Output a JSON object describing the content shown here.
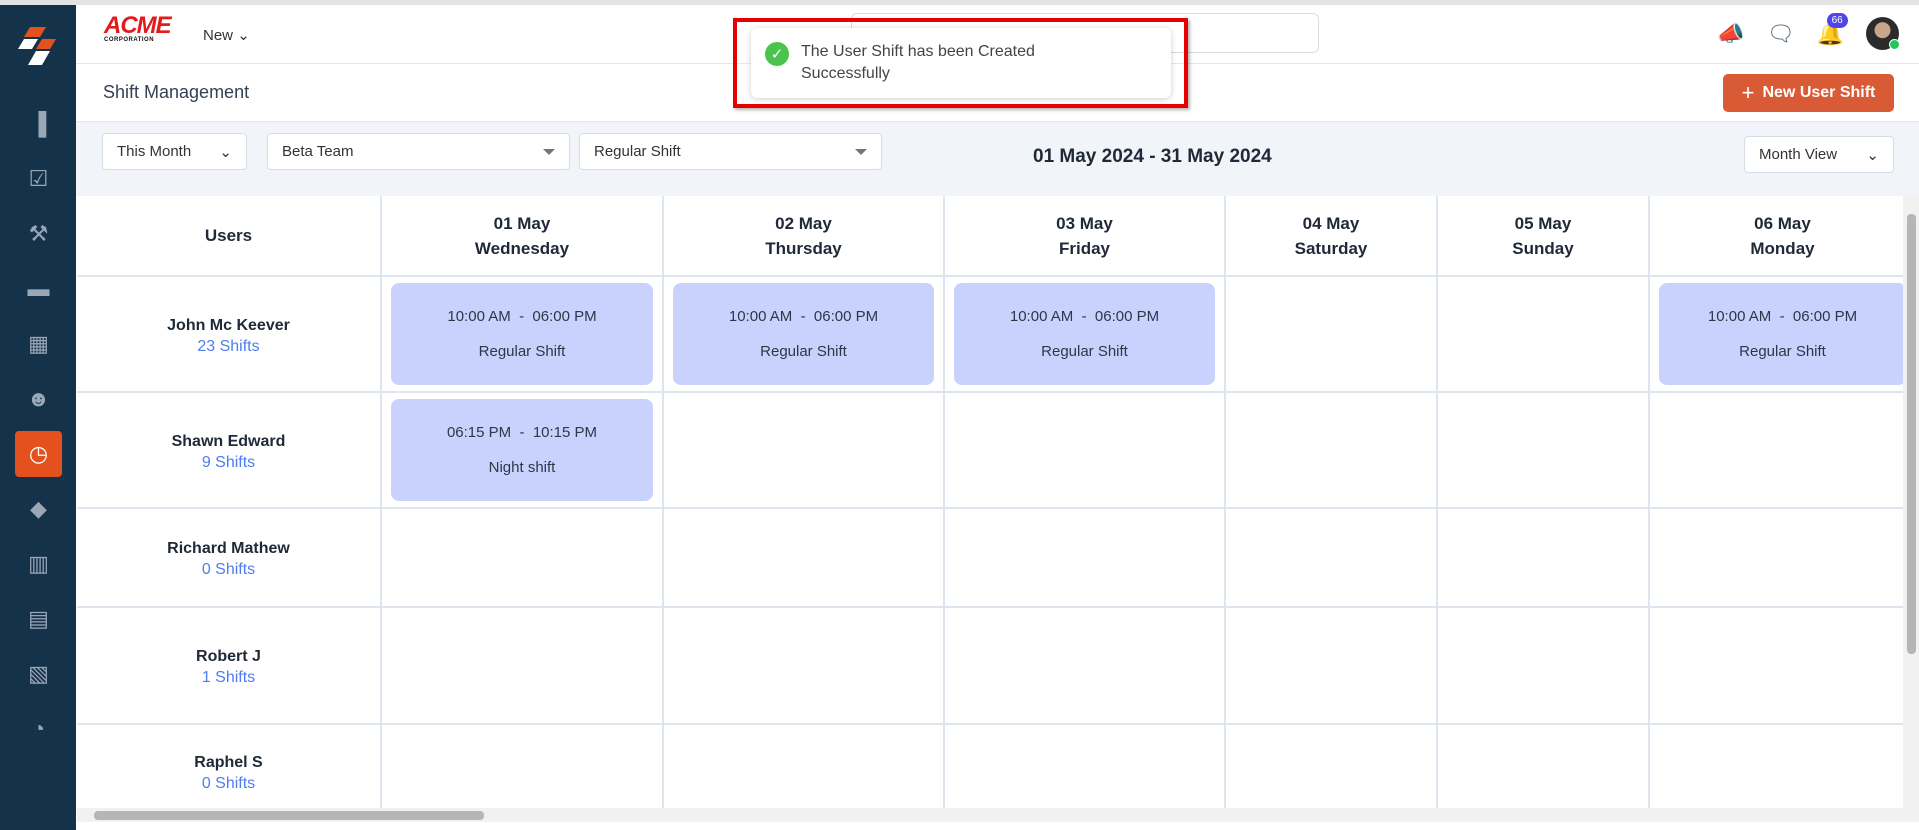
{
  "header": {
    "logo": "ACME CORPORATION",
    "logo_main": "ACME",
    "logo_sub": "CORPORATION",
    "new_label": "New",
    "notification_count": "66"
  },
  "page": {
    "title": "Shift Management",
    "new_button": "New User Shift"
  },
  "filters": {
    "period": "This Month",
    "team": "Beta Team",
    "shift_type": "Regular Shift",
    "date_range": "01 May 2024 - 31 May 2024",
    "view": "Month View"
  },
  "toast": {
    "message": "The User Shift has been Created Successfully"
  },
  "sidebar": {
    "items": [
      "chart-icon",
      "tasks-icon",
      "tools-icon",
      "briefcase-icon",
      "calendar-icon",
      "users-icon",
      "clock-icon",
      "tag-icon",
      "map-icon",
      "calculator-icon",
      "documents-icon",
      "pie-chart-icon"
    ],
    "active": "clock-icon"
  },
  "table": {
    "users_header": "Users",
    "days": [
      {
        "date": "01 May",
        "weekday": "Wednesday"
      },
      {
        "date": "02 May",
        "weekday": "Thursday"
      },
      {
        "date": "03 May",
        "weekday": "Friday"
      },
      {
        "date": "04 May",
        "weekday": "Saturday"
      },
      {
        "date": "05 May",
        "weekday": "Sunday"
      },
      {
        "date": "06 May",
        "weekday": "Monday"
      }
    ],
    "rows": [
      {
        "name": "John Mc Keever",
        "count": "23 Shifts",
        "shifts": [
          {
            "time": "10:00 AM  -  06:00 PM",
            "name": "Regular Shift"
          },
          {
            "time": "10:00 AM  -  06:00 PM",
            "name": "Regular Shift"
          },
          {
            "time": "10:00 AM  -  06:00 PM",
            "name": "Regular Shift"
          },
          null,
          null,
          {
            "time": "10:00 AM  -  06:00 PM",
            "name": "Regular Shift"
          }
        ]
      },
      {
        "name": "Shawn Edward",
        "count": "9 Shifts",
        "shifts": [
          {
            "time": "06:15 PM  -  10:15 PM",
            "name": "Night shift"
          },
          null,
          null,
          null,
          null,
          null
        ]
      },
      {
        "name": "Richard Mathew",
        "count": "0 Shifts",
        "shifts": [
          null,
          null,
          null,
          null,
          null,
          null
        ]
      },
      {
        "name": "Robert J",
        "count": "1 Shifts",
        "shifts": [
          null,
          null,
          null,
          null,
          null,
          null
        ]
      },
      {
        "name": "Raphel S",
        "count": "0 Shifts",
        "shifts": [
          null,
          null,
          null,
          null,
          null,
          null
        ]
      }
    ]
  }
}
